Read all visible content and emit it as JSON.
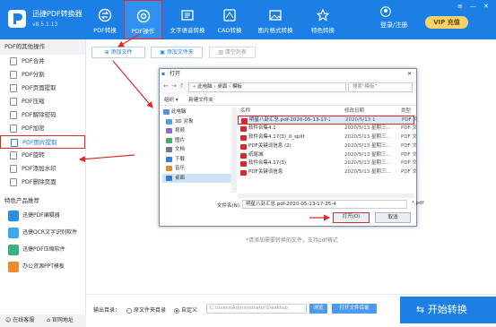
{
  "app": {
    "name": "迅捷PDF转换器",
    "version": "v8.5.1.13"
  },
  "nav": {
    "tabs": [
      {
        "label": "PDF转换"
      },
      {
        "label": "PDF操作"
      },
      {
        "label": "文字语音转换"
      },
      {
        "label": "CAD转换"
      },
      {
        "label": "图片格式转换"
      },
      {
        "label": "特色转换"
      }
    ]
  },
  "header": {
    "login": "登录/注册",
    "vip": "VIP 充值"
  },
  "sidebar": {
    "heading": "PDF的其他操作",
    "items": [
      "PDF合并",
      "PDF分割",
      "PDF页面提取",
      "PDF压缩",
      "PDF解除密码",
      "PDF加密",
      "PDF图片提取",
      "PDF旋转",
      "PDF添加水印",
      "PDF删除页面"
    ],
    "featured_title": "特色产品推荐",
    "products": [
      "迅捷PDF编辑器",
      "迅捷OCR文字识别软件",
      "迅捷PDF压缩软件",
      "办公资源PPT模板"
    ],
    "footer": {
      "online": "在线客服",
      "website": "官网地址"
    }
  },
  "toolbar": {
    "add_file": "添加文件",
    "add_folder": "添加文件夹",
    "clear": "清空列表"
  },
  "hint": "*请添加需要转换的文件，支持pdf格式",
  "bottom": {
    "output_label": "输出目录：",
    "orig_folder": "原文件夹目录",
    "custom": "自定义",
    "path": "C:\\Users\\Administrator\\Desktop",
    "browse": "浏览",
    "open_folder": "打开文件目录",
    "start": "开始转换"
  },
  "dialog": {
    "title": "打开",
    "breadcrumb": "« 此电脑 › 桌面 › 模板",
    "search": "搜索\"模板\"",
    "organize": "组织 ▾",
    "new_folder": "新建文件夹",
    "tree": [
      "此电脑",
      "3D 对象",
      "视频",
      "图片",
      "文档",
      "下载",
      "音乐",
      "桌面"
    ],
    "columns": {
      "name": "名称",
      "date": "修改日期",
      "type": "类型"
    },
    "files": [
      {
        "name": "明星八卦汇总.pdf-2020-05-13-17-25-4...",
        "date": "2020/5/13 1",
        "type": "PDF 文"
      },
      {
        "name": "软件合集4.1",
        "date": "2020/5/13 星期三...",
        "type": "PDF 文"
      },
      {
        "name": "软件合集4.17(3)_0_split",
        "date": "2020/5/13 星期三...",
        "type": "PDF 文"
      },
      {
        "name": "PDF关键词信息 (2)",
        "date": "2020/5/13 星期三...",
        "type": "PDF 文"
      },
      {
        "name": "纸尾城",
        "date": "2020/5/13 星期三...",
        "type": "PDF 文"
      },
      {
        "name": "软件合集4.17(3)",
        "date": "2020/5/13 星期三...",
        "type": "PDF 文"
      },
      {
        "name": "PDF关键词信息",
        "date": "2020/5/13 星期三...",
        "type": "PDF 文"
      }
    ],
    "filename_label": "文件名(N):",
    "filename": "明星八卦汇总.pdf-2020-05-13-17-25-4",
    "filetype": "*.pdf",
    "open": "打开(O)",
    "cancel": "取消"
  },
  "colors": {
    "brand": "#1c7fe5",
    "highlight": "#e0282e",
    "vip": "#f5d36c"
  }
}
